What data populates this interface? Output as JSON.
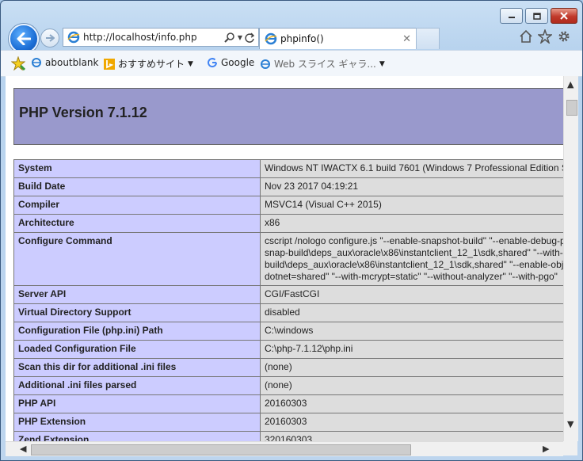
{
  "browser": {
    "address_url": "http://localhost/info.php",
    "tab_title": "phpinfo()"
  },
  "favorites": {
    "items": [
      {
        "label": "aboutblank"
      },
      {
        "label": "おすすめサイト"
      },
      {
        "label": "Google"
      },
      {
        "label": "Web スライス ギャラ..."
      }
    ]
  },
  "page": {
    "header_title": "PHP Version 7.1.12",
    "rows": [
      {
        "key": "System",
        "value": "Windows NT IWACTX 6.1 build 7601 (Windows 7 Professional Edition S"
      },
      {
        "key": "Build Date",
        "value": "Nov 23 2017 04:19:21"
      },
      {
        "key": "Compiler",
        "value": "MSVC14 (Visual C++ 2015)"
      },
      {
        "key": "Architecture",
        "value": "x86"
      },
      {
        "key": "Configure Command",
        "lines": [
          "cscript /nologo configure.js \"--enable-snapshot-build\" \"--enable-debug-p",
          "snap-build\\deps_aux\\oracle\\x86\\instantclient_12_1\\sdk,shared\" \"--with-o",
          "build\\deps_aux\\oracle\\x86\\instantclient_12_1\\sdk,shared\" \"--enable-obj",
          "dotnet=shared\" \"--with-mcrypt=static\" \"--without-analyzer\" \"--with-pgo\""
        ]
      },
      {
        "key": "Server API",
        "value": "CGI/FastCGI"
      },
      {
        "key": "Virtual Directory Support",
        "value": "disabled"
      },
      {
        "key": "Configuration File (php.ini) Path",
        "value": "C:\\windows"
      },
      {
        "key": "Loaded Configuration File",
        "value": "C:\\php-7.1.12\\php.ini"
      },
      {
        "key": "Scan this dir for additional .ini files",
        "value": "(none)"
      },
      {
        "key": "Additional .ini files parsed",
        "value": "(none)"
      },
      {
        "key": "PHP API",
        "value": "20160303"
      },
      {
        "key": "PHP Extension",
        "value": "20160303"
      },
      {
        "key": "Zend Extension",
        "value": "320160303"
      }
    ]
  },
  "icons": {
    "back": "back-arrow-icon",
    "forward": "forward-arrow-icon",
    "home": "home-icon",
    "favorites": "star-icon",
    "tools": "gear-icon"
  }
}
